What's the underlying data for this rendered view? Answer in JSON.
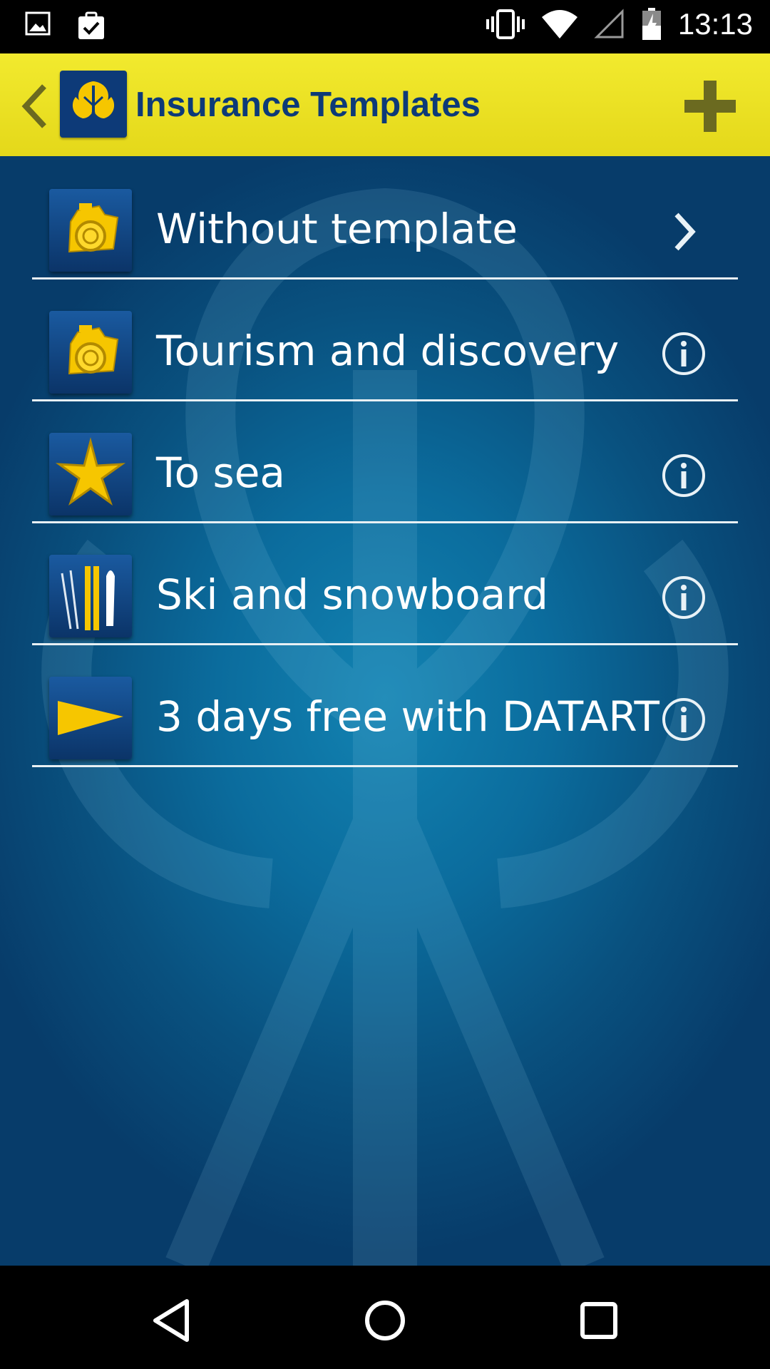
{
  "status_bar": {
    "time": "13:13",
    "left_icons": [
      "image-icon",
      "clipboard-check-icon"
    ],
    "right_icons": [
      "vibrate-icon",
      "wifi-icon",
      "signal-icon",
      "battery-charging-icon"
    ]
  },
  "app_bar": {
    "title": "Insurance Templates",
    "back_icon": "chevron-left-icon",
    "logo_icon": "leaf-logo-icon",
    "add_icon": "plus-icon"
  },
  "colors": {
    "app_bar_yellow": "#f2ea2e",
    "brand_navy": "#0d3a78",
    "accent_yellow": "#f6c600",
    "content_blue": "#0b6c9d"
  },
  "templates": [
    {
      "label": "Without template",
      "icon": "camera-icon",
      "action": "chevron-right-icon"
    },
    {
      "label": "Tourism and discovery",
      "icon": "camera-icon",
      "action": "info-icon"
    },
    {
      "label": "To sea",
      "icon": "starfish-icon",
      "action": "info-icon"
    },
    {
      "label": "Ski and snowboard",
      "icon": "ski-icon",
      "action": "info-icon"
    },
    {
      "label": "3 days free with DATART",
      "icon": "play-arrow-icon",
      "action": "info-icon"
    }
  ],
  "nav_bar": {
    "back": "triangle-back-icon",
    "home": "circle-home-icon",
    "recents": "square-recents-icon"
  }
}
